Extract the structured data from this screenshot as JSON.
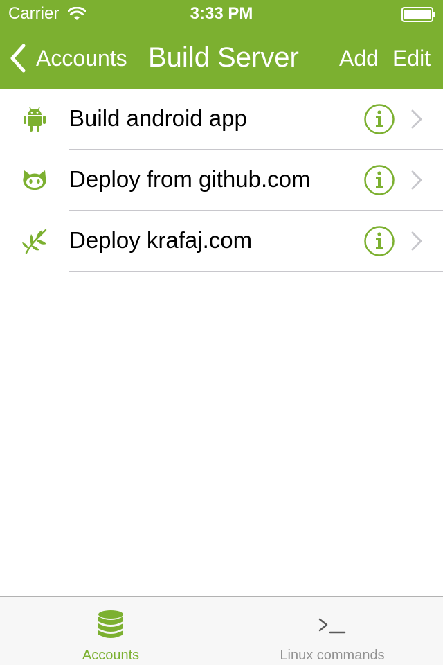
{
  "colors": {
    "accent": "#7cb030",
    "tab_inactive": "#929292",
    "chevron": "#c7c7cc"
  },
  "status_bar": {
    "carrier": "Carrier",
    "time": "3:33 PM"
  },
  "nav": {
    "back_label": "Accounts",
    "title": "Build Server",
    "add_label": "Add",
    "edit_label": "Edit"
  },
  "list": {
    "items": [
      {
        "label": "Build android app",
        "icon": "android-icon"
      },
      {
        "label": "Deploy from github.com",
        "icon": "github-icon"
      },
      {
        "label": "Deploy krafaj.com",
        "icon": "leaf-icon"
      }
    ]
  },
  "tab_bar": {
    "items": [
      {
        "label": "Accounts",
        "icon": "database-icon",
        "selected": true
      },
      {
        "label": "Linux commands",
        "icon": "terminal-icon",
        "selected": false
      }
    ]
  }
}
